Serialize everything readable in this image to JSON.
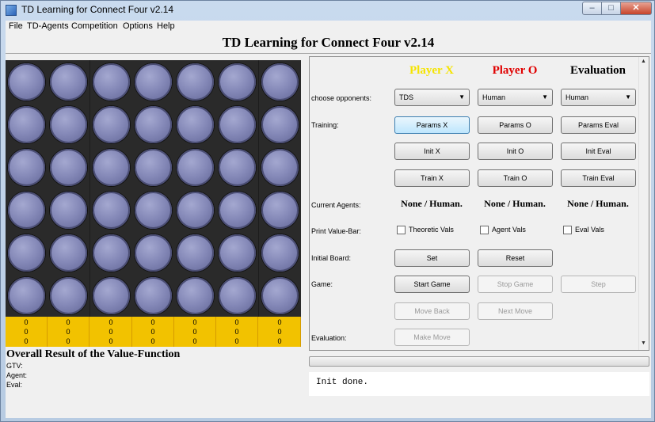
{
  "window": {
    "title": "TD Learning for Connect Four v2.14",
    "controls": {
      "minimize": "–",
      "maximize": "□",
      "close": "✕"
    }
  },
  "menu": [
    "File",
    "TD-Agents",
    "Competition",
    "Options",
    "Help"
  ],
  "main_title": "TD Learning for Connect Four v2.14",
  "board": {
    "rows": 6,
    "cols": 7,
    "cells": "all empty",
    "value_bar": [
      [
        "0",
        "0",
        "0"
      ],
      [
        "0",
        "0",
        "0"
      ],
      [
        "0",
        "0",
        "0"
      ],
      [
        "0",
        "0",
        "0"
      ],
      [
        "0",
        "0",
        "0"
      ],
      [
        "0",
        "0",
        "0"
      ],
      [
        "0",
        "0",
        "0"
      ]
    ]
  },
  "result": {
    "title": "Overall Result of the Value-Function",
    "gtv_label": "GTV:",
    "agent_label": "Agent:",
    "eval_label": "Eval:"
  },
  "panel": {
    "columns": [
      {
        "header": "Player X",
        "color": "#f5e400"
      },
      {
        "header": "Player O",
        "color": "#e00000"
      },
      {
        "header": "Evaluation",
        "color": "#000000"
      }
    ],
    "labels": {
      "opponents": "choose opponents:",
      "training": "Training:",
      "current_agents": "Current Agents:",
      "print_value_bar": "Print Value-Bar:",
      "initial_board": "Initial Board:",
      "game": "Game:",
      "evaluation": "Evaluation:"
    },
    "opponents": [
      "TDS",
      "Human",
      "Human"
    ],
    "params": [
      "Params X",
      "Params O",
      "Params Eval"
    ],
    "init": [
      "Init X",
      "Init O",
      "Init Eval"
    ],
    "train": [
      "Train X",
      "Train O",
      "Train Eval"
    ],
    "current_agents": [
      "None / Human.",
      "None / Human.",
      "None / Human."
    ],
    "checkboxes": [
      {
        "label": "Theoretic Vals",
        "checked": false
      },
      {
        "label": "Agent Vals",
        "checked": false
      },
      {
        "label": "Eval Vals",
        "checked": false
      }
    ],
    "set": "Set",
    "reset": "Reset",
    "start_game": "Start Game",
    "stop_game": "Stop Game",
    "step": "Step",
    "move_back": "Move Back",
    "next_move": "Next Move",
    "make_move": "Make Move"
  },
  "status": "Init done."
}
